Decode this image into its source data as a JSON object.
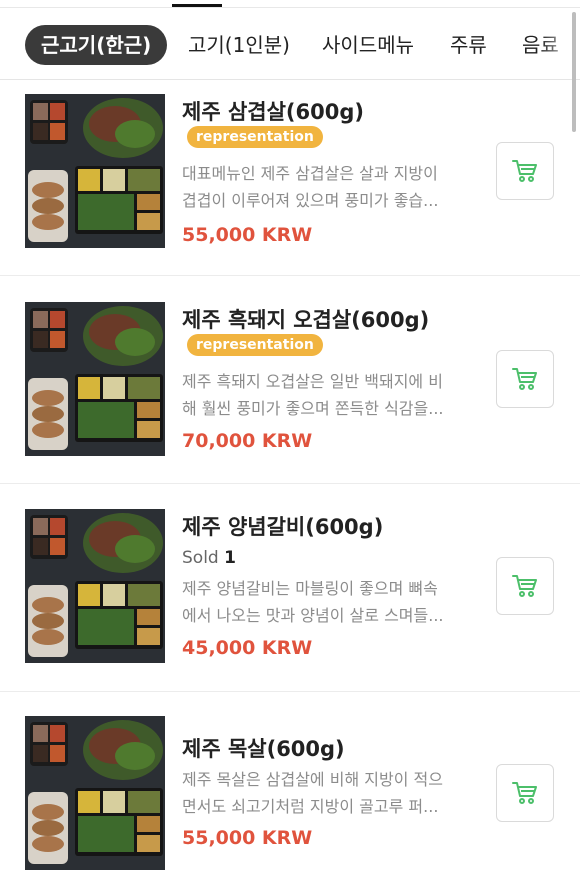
{
  "tabs": [
    {
      "label": "근고기(한근)",
      "active": true
    },
    {
      "label": "고기(1인분)",
      "active": false
    },
    {
      "label": "사이드메뉴",
      "active": false
    },
    {
      "label": "주류",
      "active": false
    },
    {
      "label": "음료",
      "active": false
    }
  ],
  "items": [
    {
      "title": "제주 삼겹살(600g)",
      "badge": "representation",
      "desc_line1": "대표메뉴인 제주 삼겹살은 살과 지방이",
      "desc_line2": "겹겹이 이루어져 있으며 풍미가 좋습...",
      "price": "55,000 KRW"
    },
    {
      "title": "제주 흑돼지 오겹살(600g)",
      "badge": "representation",
      "desc_line1": "제주 흑돼지 오겹살은 일반 백돼지에 비",
      "desc_line2": "해 훨씬 풍미가 좋으며 쫀득한 식감을...",
      "price": "70,000 KRW"
    },
    {
      "title": "제주 양념갈비(600g)",
      "sold_label": "Sold",
      "sold_count": "1",
      "desc_line1": "제주 양념갈비는 마블링이 좋으며 뼈속",
      "desc_line2": "에서 나오는 맛과 양념이 살로 스며들...",
      "price": "45,000 KRW"
    },
    {
      "title": "제주 목살(600g)",
      "desc_line1": "제주 목살은 삼겹살에 비해 지방이 적으",
      "desc_line2": "면서도 쇠고기처럼 지방이 골고루 퍼...",
      "price": "55,000 KRW"
    }
  ],
  "colors": {
    "active_tab_bg": "#3a3a3a",
    "badge_bg": "#f1b43f",
    "price": "#e0533d",
    "cart_icon": "#4cbf6a"
  },
  "icons": {
    "cart": "shopping-cart-icon"
  }
}
